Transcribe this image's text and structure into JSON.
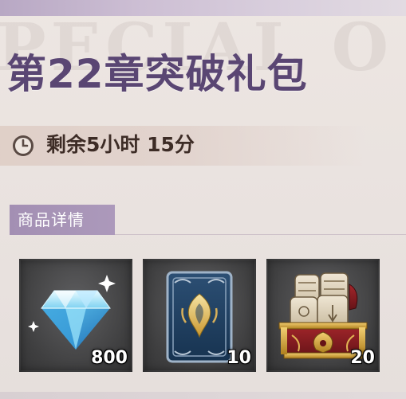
{
  "header": {
    "title": "第22章突破礼包",
    "watermark": "PECIAL O"
  },
  "timer": {
    "icon": "clock-icon",
    "text": "剩余5小时 15分"
  },
  "section": {
    "label": "商品详情"
  },
  "items": [
    {
      "icon": "diamond-icon",
      "quantity": "800"
    },
    {
      "icon": "card-icon",
      "quantity": "10"
    },
    {
      "icon": "treasure-chest-icon",
      "quantity": "20"
    }
  ],
  "colors": {
    "title": "#5a4673",
    "tab": "#a38fb3",
    "card_bg": "#3f3f40"
  }
}
